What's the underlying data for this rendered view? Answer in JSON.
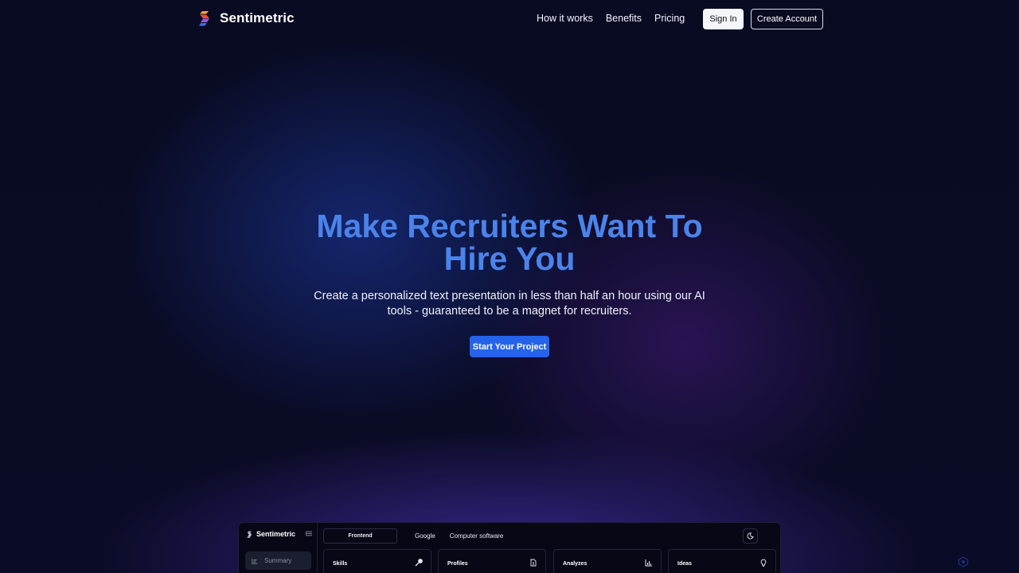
{
  "nav": {
    "brand": "Sentimetric",
    "links": [
      "How it works",
      "Benefits",
      "Pricing"
    ],
    "sign_in": "Sign In",
    "create_account": "Create Account"
  },
  "hero": {
    "title": "Make Recruiters Want To Hire You",
    "subtitle": "Create a personalized text presentation in less than half an hour using our AI tools - guaranteed to be a magnet for recruiters.",
    "cta": "Start Your Project"
  },
  "preview": {
    "brand": "Sentimetric",
    "sidebar_item": "Summary",
    "tabs": [
      "Frontend",
      "Google",
      "Computer software"
    ],
    "cards": [
      {
        "label": "Skills",
        "icon": "wrench-icon"
      },
      {
        "label": "Profiles",
        "icon": "document-icon"
      },
      {
        "label": "Analyzes",
        "icon": "bar-chart-icon"
      },
      {
        "label": "Ideas",
        "icon": "lightbulb-icon"
      }
    ]
  },
  "colors": {
    "background": "#080a1e",
    "accent": "#2563eb",
    "title": "#4b83ea"
  }
}
